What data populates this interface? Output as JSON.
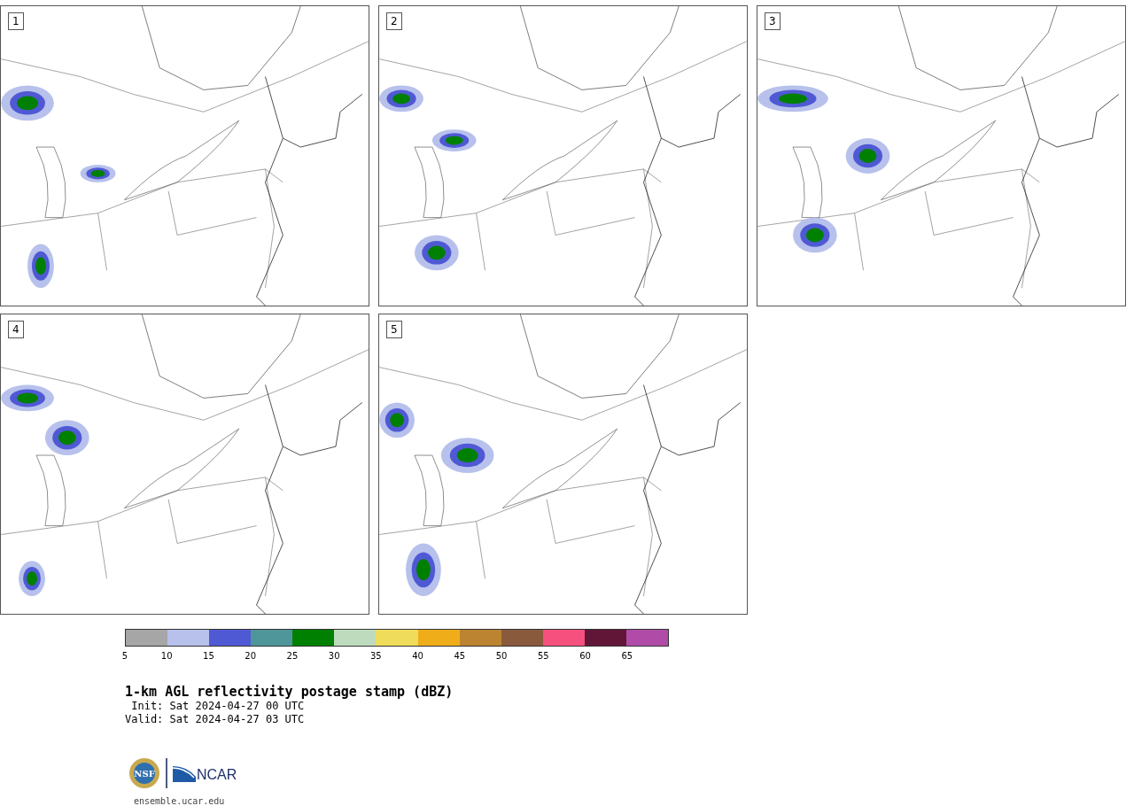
{
  "panels": [
    {
      "label": "1"
    },
    {
      "label": "2"
    },
    {
      "label": "3"
    },
    {
      "label": "4"
    },
    {
      "label": "5"
    }
  ],
  "colorbar": {
    "bins": [
      {
        "color": "#a6a6a6"
      },
      {
        "color": "#b7c1ec"
      },
      {
        "color": "#5059d4"
      },
      {
        "color": "#4f969b"
      },
      {
        "color": "#008000"
      },
      {
        "color": "#bedcbd"
      },
      {
        "color": "#efdc5a"
      },
      {
        "color": "#efad1a"
      },
      {
        "color": "#bc8430"
      },
      {
        "color": "#8a5a3c"
      },
      {
        "color": "#f5507e"
      },
      {
        "color": "#611637"
      },
      {
        "color": "#b04ca7"
      }
    ],
    "ticks": [
      "5",
      "10",
      "15",
      "20",
      "25",
      "30",
      "35",
      "40",
      "45",
      "50",
      "55",
      "60",
      "65"
    ]
  },
  "title": "1-km AGL reflectivity postage stamp (dBZ)",
  "init": " Init: Sat 2024-04-27 00 UTC",
  "valid": "Valid: Sat 2024-04-27 03 UTC",
  "logo": {
    "seal_text": "NSF",
    "wordmark": "NCAR"
  },
  "url": "ensemble.ucar.edu"
}
